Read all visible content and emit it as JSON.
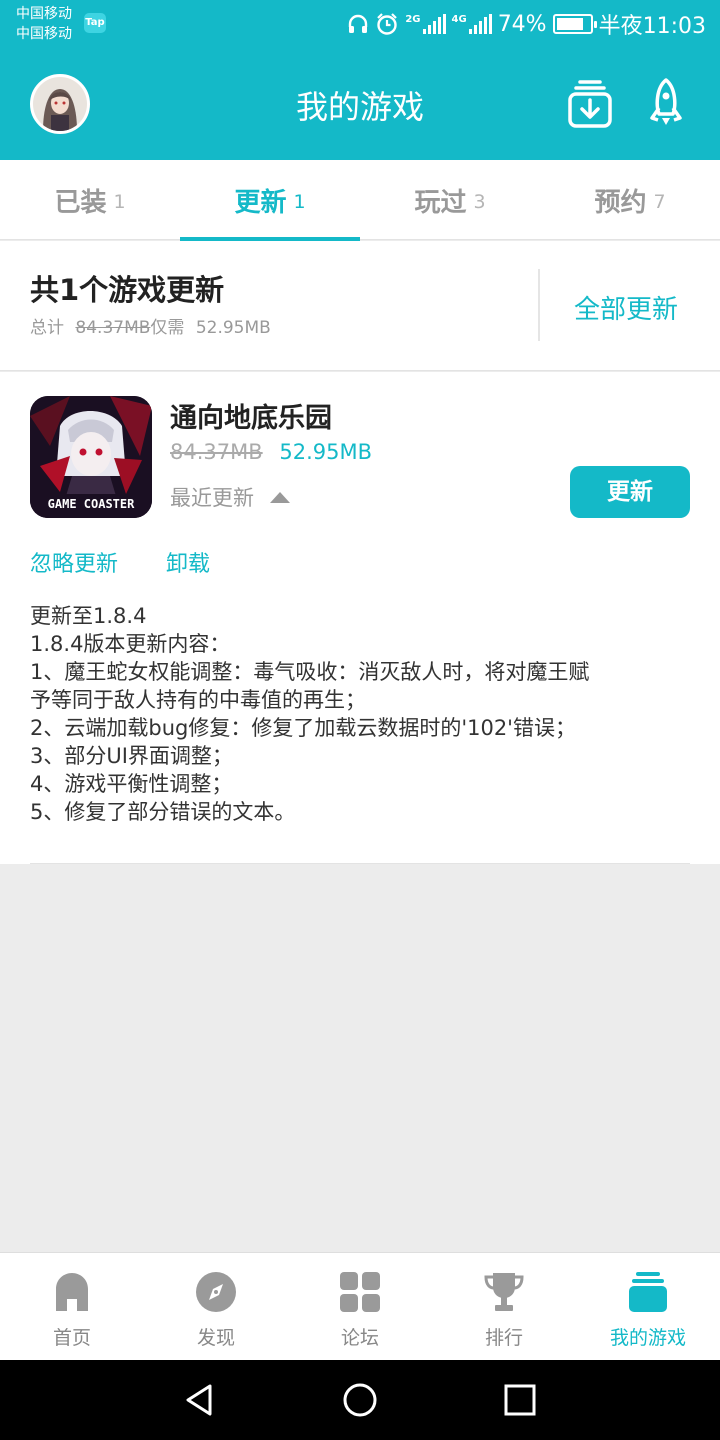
{
  "status_bar": {
    "carrier_1": "中国移动",
    "carrier_2": "中国移动",
    "tap_badge": "Tap",
    "network_1": "2G",
    "network_2": "4G",
    "battery": "74%",
    "time": "半夜11:03"
  },
  "app_bar": {
    "title": "我的游戏"
  },
  "tabs": [
    {
      "label": "已装",
      "count": "1"
    },
    {
      "label": "更新",
      "count": "1",
      "active": true
    },
    {
      "label": "玩过",
      "count": "3"
    },
    {
      "label": "预约",
      "count": "7"
    }
  ],
  "summary": {
    "title": "共1个游戏更新",
    "total_prefix": "总计",
    "total_size": "84.37MB",
    "only_need_prefix": "仅需",
    "need_size": "52.95MB",
    "update_all": "全部更新"
  },
  "game": {
    "name": "通向地底乐园",
    "icon_caption": "GAME COASTER",
    "old_size": "84.37MB",
    "new_size": "52.95MB",
    "recent_label": "最近更新",
    "update_button": "更新",
    "ignore_link": "忽略更新",
    "uninstall_link": "卸载",
    "notes": [
      "更新至1.8.4",
      "1.8.4版本更新内容：",
      "1、魔王蛇女权能调整：毒气吸收：消灭敌人时，将对魔王赋",
      "予等同于敌人持有的中毒值的再生；",
      "2、云端加载bug修复：修复了加载云数据时的'102'错误；",
      "3、部分UI界面调整；",
      "4、游戏平衡性调整；",
      "5、修复了部分错误的文本。"
    ]
  },
  "bottom_nav": [
    {
      "label": "首页",
      "icon": "home-icon"
    },
    {
      "label": "发现",
      "icon": "compass-icon"
    },
    {
      "label": "论坛",
      "icon": "grid-icon"
    },
    {
      "label": "排行",
      "icon": "trophy-icon"
    },
    {
      "label": "我的游戏",
      "icon": "stack-icon",
      "active": true
    }
  ],
  "colors": {
    "accent": "#14b9c8",
    "muted": "#999999",
    "background": "#ececec"
  }
}
